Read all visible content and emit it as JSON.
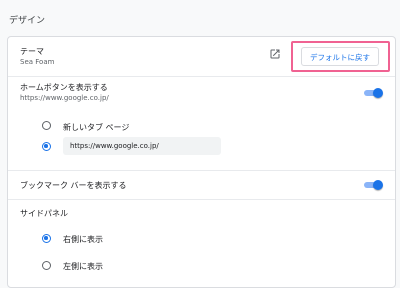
{
  "section_title": "デザイン",
  "theme": {
    "label": "テーマ",
    "value": "Sea Foam",
    "reset_button": "デフォルトに戻す"
  },
  "home_button": {
    "label": "ホームボタンを表示する",
    "url": "https://www.google.co.jp/",
    "enabled": true,
    "options": {
      "new_tab": "新しいタブ ページ",
      "custom_url": "https://www.google.co.jp/"
    },
    "selected": "custom_url"
  },
  "bookmarks_bar": {
    "label": "ブックマーク バーを表示する",
    "enabled": true
  },
  "side_panel": {
    "label": "サイドパネル",
    "options": {
      "right": "右側に表示",
      "left": "左側に表示"
    },
    "selected": "right"
  },
  "colors": {
    "accent": "#1a73e8",
    "highlight": "#f06292"
  },
  "icons": {
    "external": "open-in-new-icon"
  }
}
